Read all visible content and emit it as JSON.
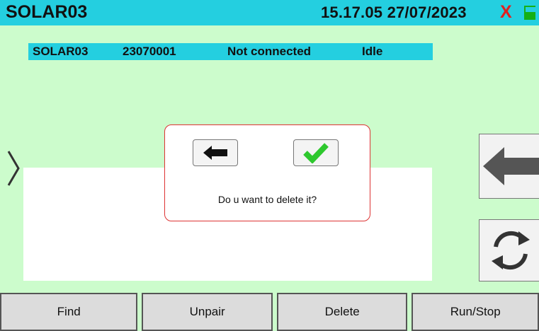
{
  "header": {
    "title": "SOLAR03",
    "time": "15.17.05",
    "date": "27/07/2023",
    "close_glyph": "X"
  },
  "device": {
    "name": "SOLAR03",
    "serial": "23070001",
    "connection": "Not connected",
    "state": "Idle"
  },
  "dialog": {
    "message": "Do u want to delete it?",
    "back_icon": "back-arrow-icon",
    "confirm_icon": "checkmark-icon"
  },
  "side_buttons": {
    "back_icon": "back-arrow-icon",
    "refresh_icon": "refresh-icon"
  },
  "bottom_bar": {
    "find": "Find",
    "unpair": "Unpair",
    "delete": "Delete",
    "run_stop": "Run/Stop"
  },
  "colors": {
    "background": "#ccfccc",
    "header": "#24cfe0",
    "dialog_border": "#dd3333",
    "confirm": "#2ec82e",
    "close": "#e02020",
    "battery": "#15b015"
  }
}
